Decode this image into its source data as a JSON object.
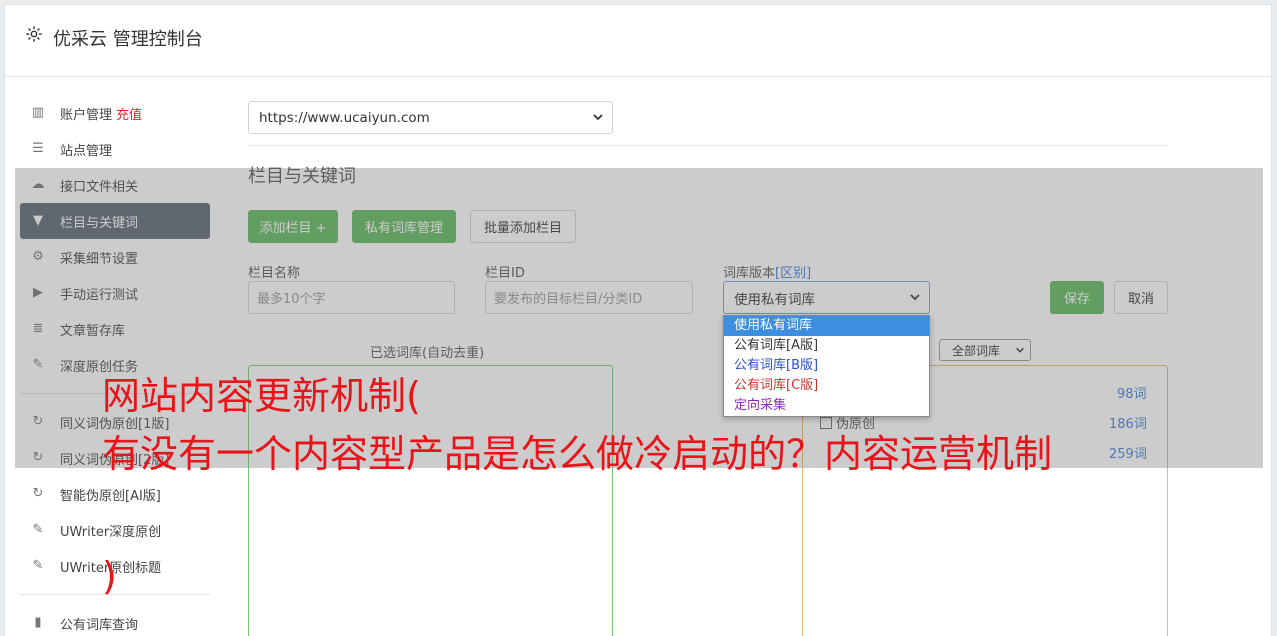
{
  "header": {
    "title": "优采云 管理控制台"
  },
  "sidebar": {
    "items": [
      {
        "label": "账户管理",
        "badge": "充值",
        "icon": "bar-chart-icon"
      },
      {
        "label": "站点管理",
        "icon": "server-icon"
      },
      {
        "label": "接口文件相关",
        "icon": "cloud-upload-icon"
      },
      {
        "label": "栏目与关键词",
        "icon": "filter-icon",
        "active": true
      },
      {
        "label": "采集细节设置",
        "icon": "cogs-icon"
      },
      {
        "label": "手动运行测试",
        "icon": "play-icon"
      },
      {
        "label": "文章暂存库",
        "icon": "database-icon"
      },
      {
        "label": "深度原创任务",
        "icon": "edit-icon"
      },
      {
        "label": "同义词伪原创[1版]",
        "icon": "refresh-icon"
      },
      {
        "label": "同义词伪原创[2版]",
        "icon": "refresh-icon"
      },
      {
        "label": "智能伪原创[AI版]",
        "icon": "refresh-icon"
      },
      {
        "label": "UWriter深度原创",
        "icon": "edit-icon"
      },
      {
        "label": "UWriter原创标题",
        "icon": "edit-icon"
      },
      {
        "label": "公有词库查询",
        "icon": "book-icon"
      }
    ]
  },
  "main": {
    "site_select": "https://www.ucaiyun.com",
    "section_title": "栏目与关键词",
    "buttons": {
      "add_column": "添加栏目 +",
      "private_lib": "私有词库管理",
      "batch_add": "批量添加栏目",
      "save": "保存",
      "cancel": "取消"
    },
    "form": {
      "name_label": "栏目名称",
      "name_placeholder": "最多10个字",
      "id_label": "栏目ID",
      "id_placeholder": "要发布的目标栏目/分类ID",
      "version_label": "词库版本",
      "version_link": "[区别]",
      "version_value": "使用私有词库"
    },
    "dropdown_options": [
      "使用私有词库",
      "公有词库[A版]",
      "公有词库[B版]",
      "公有词库[C版]",
      "定向采集"
    ],
    "selected_title": "已选词库(自动去重)",
    "filter_select": "全部词库",
    "word_rows": [
      {
        "label": "",
        "count": "98词"
      },
      {
        "label": "伪原创",
        "count": "186词"
      },
      {
        "label": "",
        "count": "259词"
      }
    ]
  },
  "caption": {
    "line1": "网站内容更新机制(",
    "line2": "有没有一个内容型产品是怎么做冷启动的？内容运营机制",
    "line3": ")"
  }
}
